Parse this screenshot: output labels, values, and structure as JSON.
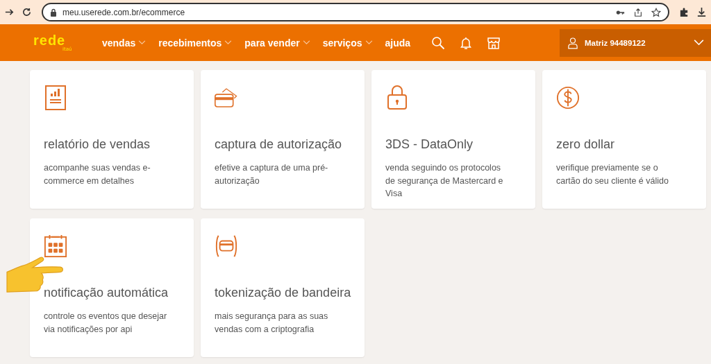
{
  "browser": {
    "url": "meu.userede.com.br/ecommerce"
  },
  "header": {
    "logo": "rede",
    "logo_sub": "itaú",
    "nav": [
      {
        "label": "vendas",
        "has_menu": true
      },
      {
        "label": "recebimentos",
        "has_menu": true
      },
      {
        "label": "para vender",
        "has_menu": true
      },
      {
        "label": "serviços",
        "has_menu": true
      },
      {
        "label": "ajuda",
        "has_menu": false
      }
    ],
    "account": "Matriz 94489122"
  },
  "cards": [
    {
      "kind": "report",
      "title": "relatório de vendas",
      "description": "acompanhe suas vendas e-commerce em detalhes"
    },
    {
      "kind": "card",
      "title": "captura de autorização",
      "description": "efetive a captura de uma pré-autorização"
    },
    {
      "kind": "lock",
      "title": "3DS - DataOnly",
      "description": "venda seguindo os protocolos de segurança de Mastercard e Visa"
    },
    {
      "kind": "dollar",
      "title": "zero dollar",
      "description": "verifique previamente se o cartão do seu cliente é válido"
    },
    {
      "kind": "calendar",
      "title": "notificação automática",
      "description": "controle os eventos que desejar via notificações por api"
    },
    {
      "kind": "token",
      "title": "tokenização de bandeira",
      "description": "mais segurança para as suas vendas com a criptografia"
    }
  ]
}
